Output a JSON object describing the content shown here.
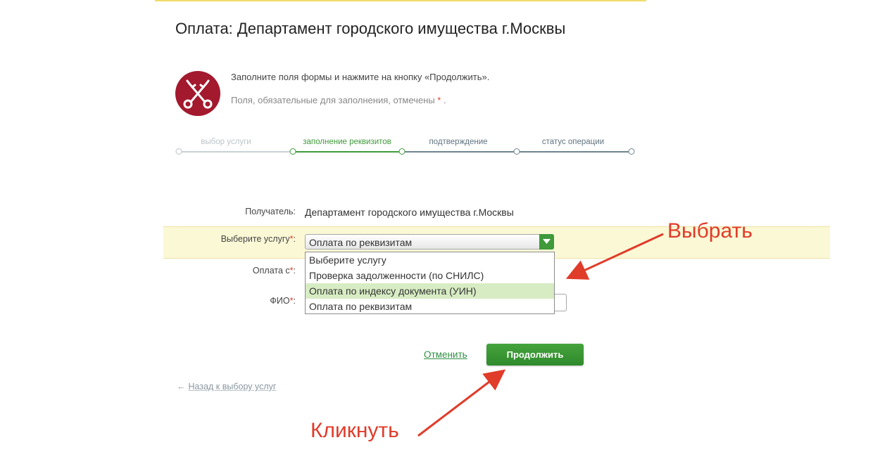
{
  "page": {
    "title": "Оплата: Департамент городского имущества г.Москвы",
    "intro": "Заполните поля формы и нажмите на кнопку «Продолжить».",
    "required_note_text": "Поля, обязательные для заполнения, отмечены",
    "required_marker": "*",
    "required_note_end": "."
  },
  "steps": [
    {
      "label": "выбор услуги",
      "state": "done"
    },
    {
      "label": "заполнение реквизитов",
      "state": "active"
    },
    {
      "label": "подтверждение",
      "state": "pending"
    },
    {
      "label": "статус операции",
      "state": "pending"
    }
  ],
  "form": {
    "recipient_label": "Получатель:",
    "recipient_value": "Департамент городского имущества г.Москвы",
    "service_label": "Выберите услугу",
    "service_selected": "Оплата по реквизитам",
    "payment_from_label": "Оплата с",
    "fio_label": "ФИО",
    "service_options": [
      "Выберите услугу",
      "Проверка задолженности (по СНИЛС)",
      "Оплата по индексу документа (УИН)",
      "Оплата по реквизитам"
    ],
    "highlighted_option_index": 2
  },
  "actions": {
    "cancel_label": "Отменить",
    "continue_label": "Продолжить",
    "back_arrow": "←",
    "back_label": "Назад к выбору услуг"
  },
  "annotations": {
    "select_text": "Выбрать",
    "click_text": "Кликнуть"
  },
  "colors": {
    "brand_green": "#3f9a3a",
    "annotation_red": "#e03c2a",
    "logo_red": "#a3192e",
    "highlight_yellow": "#fbf8d6"
  },
  "icons": {
    "logo": "crossed-keys-icon",
    "select_arrow": "chevron-down-icon",
    "back": "arrow-left-icon"
  }
}
